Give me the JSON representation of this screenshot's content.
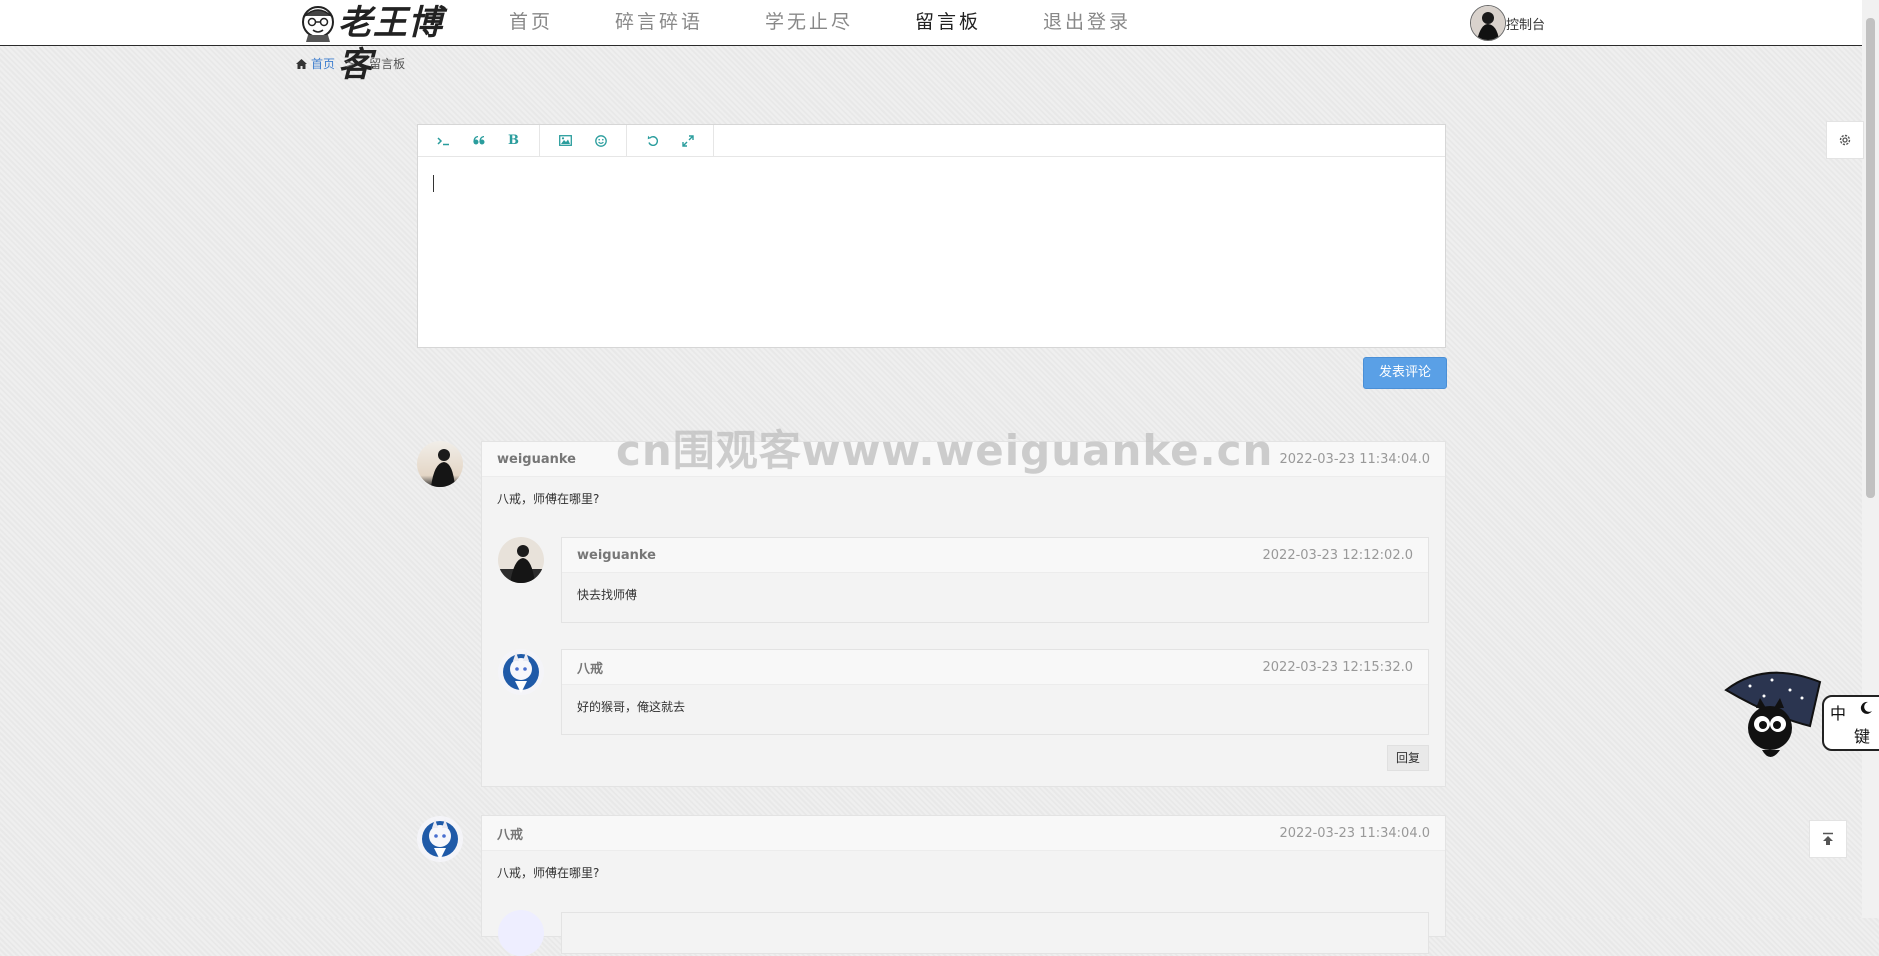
{
  "header": {
    "logo_text": "老王博客",
    "nav": [
      "首页",
      "碎言碎语",
      "学无止尽",
      "留言板",
      "退出登录"
    ],
    "active_index": 3,
    "console_label": "控制台"
  },
  "breadcrumb": {
    "home": "首页",
    "separator": ">",
    "current": "留言板"
  },
  "editor": {
    "toolbar": [
      "terminal-icon",
      "quote-icon",
      "bold-icon",
      "image-icon",
      "emoji-icon",
      "undo-icon",
      "fullscreen-icon"
    ],
    "bold_glyph": "B",
    "submit_label": "发表评论"
  },
  "watermark": "cn围观客www.weiguanke.cn",
  "comments": [
    {
      "name": "weiguanke",
      "time": "2022-03-23 11:34:04.0",
      "text": "八戒，师傅在哪里?",
      "replies": [
        {
          "name": "weiguanke",
          "time": "2022-03-23 12:12:02.0",
          "text": "快去找师傅"
        },
        {
          "name": "八戒",
          "time": "2022-03-23 12:15:32.0",
          "text": "好的猴哥，俺这就去"
        }
      ],
      "reply_label": "回复"
    },
    {
      "name": "八戒",
      "time": "2022-03-23 11:34:04.0",
      "text": "八戒，师傅在哪里?"
    }
  ],
  "ime": {
    "mode": "中",
    "key": "键"
  },
  "colors": {
    "accent": "#5aa0e6",
    "link": "#3f7fcf",
    "toolbar_icon": "#2a9d9d"
  }
}
